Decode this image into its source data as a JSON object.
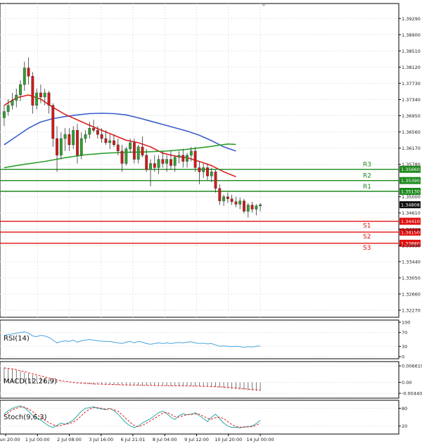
{
  "chart_data": {
    "type": "candlestick",
    "price_axis": {
      "min": 1.321,
      "max": 1.3965,
      "ticks": [
        "1.39290",
        "1.38900",
        "1.38510",
        "1.38120",
        "1.37730",
        "1.37340",
        "1.36950",
        "1.36560",
        "1.36170",
        "1.35780",
        "1.35000",
        "1.34610",
        "1.34220",
        "1.33830",
        "1.33440",
        "1.33050",
        "1.32660",
        "1.32270"
      ]
    },
    "time_axis": {
      "labels": [
        "30 Jun 20:00",
        "1 Jul 00:00",
        "2 Jul 08:00",
        "3 Jul 16:00",
        "6 Jul 21:01",
        "8 Jul 04:00",
        "9 Jul 12:00",
        "10 Jul 20:00",
        "14 Jul 00:00"
      ],
      "n_bars": 64
    },
    "current_price": {
      "label": "1.34808",
      "value": 1.34808
    },
    "candles": [
      [
        1.369,
        1.372,
        1.367,
        1.3705
      ],
      [
        1.3705,
        1.3735,
        1.3695,
        1.372
      ],
      [
        1.372,
        1.375,
        1.371,
        1.3732
      ],
      [
        1.3732,
        1.376,
        1.3715,
        1.3745
      ],
      [
        1.3745,
        1.378,
        1.373,
        1.377
      ],
      [
        1.377,
        1.3825,
        1.3755,
        1.381
      ],
      [
        1.381,
        1.3835,
        1.377,
        1.379
      ],
      [
        1.379,
        1.38,
        1.37,
        1.372
      ],
      [
        1.372,
        1.376,
        1.371,
        1.375
      ],
      [
        1.375,
        1.377,
        1.3725,
        1.374
      ],
      [
        1.374,
        1.376,
        1.372,
        1.375
      ],
      [
        1.375,
        1.3755,
        1.37,
        1.372
      ],
      [
        1.372,
        1.3725,
        1.362,
        1.364
      ],
      [
        1.364,
        1.367,
        1.356,
        1.36
      ],
      [
        1.36,
        1.3655,
        1.359,
        1.364
      ],
      [
        1.364,
        1.3665,
        1.361,
        1.365
      ],
      [
        1.365,
        1.3665,
        1.361,
        1.3625
      ],
      [
        1.3625,
        1.367,
        1.3615,
        1.366
      ],
      [
        1.366,
        1.3675,
        1.358,
        1.36
      ],
      [
        1.36,
        1.3655,
        1.359,
        1.364
      ],
      [
        1.364,
        1.366,
        1.363,
        1.365
      ],
      [
        1.365,
        1.368,
        1.364,
        1.3665
      ],
      [
        1.3665,
        1.3685,
        1.3655,
        1.366
      ],
      [
        1.366,
        1.367,
        1.364,
        1.365
      ],
      [
        1.365,
        1.3665,
        1.363,
        1.364
      ],
      [
        1.364,
        1.366,
        1.3625,
        1.363
      ],
      [
        1.363,
        1.365,
        1.3615,
        1.3635
      ],
      [
        1.3635,
        1.365,
        1.362,
        1.3625
      ],
      [
        1.3625,
        1.364,
        1.36,
        1.361
      ],
      [
        1.361,
        1.3625,
        1.356,
        1.358
      ],
      [
        1.358,
        1.362,
        1.3575,
        1.3615
      ],
      [
        1.3615,
        1.364,
        1.3605,
        1.363
      ],
      [
        1.363,
        1.364,
        1.358,
        1.359
      ],
      [
        1.359,
        1.3625,
        1.358,
        1.362
      ],
      [
        1.362,
        1.3645,
        1.3595,
        1.36
      ],
      [
        1.36,
        1.3615,
        1.356,
        1.3565
      ],
      [
        1.3565,
        1.359,
        1.3525,
        1.358
      ],
      [
        1.358,
        1.36,
        1.356,
        1.357
      ],
      [
        1.357,
        1.36,
        1.3555,
        1.359
      ],
      [
        1.359,
        1.361,
        1.357,
        1.358
      ],
      [
        1.358,
        1.36,
        1.356,
        1.359
      ],
      [
        1.359,
        1.361,
        1.3565,
        1.3575
      ],
      [
        1.3575,
        1.36,
        1.356,
        1.3595
      ],
      [
        1.3595,
        1.361,
        1.358,
        1.36
      ],
      [
        1.36,
        1.3615,
        1.357,
        1.3585
      ],
      [
        1.3585,
        1.3605,
        1.357,
        1.36
      ],
      [
        1.36,
        1.362,
        1.3585,
        1.361
      ],
      [
        1.361,
        1.362,
        1.356,
        1.357
      ],
      [
        1.357,
        1.3585,
        1.353,
        1.356
      ],
      [
        1.356,
        1.358,
        1.3545,
        1.357
      ],
      [
        1.357,
        1.358,
        1.354,
        1.355
      ],
      [
        1.355,
        1.357,
        1.3535,
        1.356
      ],
      [
        1.356,
        1.3565,
        1.351,
        1.352
      ],
      [
        1.352,
        1.353,
        1.348,
        1.349
      ],
      [
        1.349,
        1.3505,
        1.3478,
        1.35
      ],
      [
        1.35,
        1.351,
        1.3485,
        1.3495
      ],
      [
        1.3495,
        1.3505,
        1.348,
        1.3488
      ],
      [
        1.3488,
        1.35,
        1.3475,
        1.3482
      ],
      [
        1.3482,
        1.3498,
        1.347,
        1.349
      ],
      [
        1.349,
        1.3495,
        1.346,
        1.3465
      ],
      [
        1.3465,
        1.3485,
        1.345,
        1.348
      ],
      [
        1.348,
        1.3488,
        1.3462,
        1.347
      ],
      [
        1.347,
        1.3482,
        1.3455,
        1.3478
      ],
      [
        1.3478,
        1.3485,
        1.3465,
        1.34808
      ]
    ],
    "moving_averages": [
      {
        "color": "#3a5fcd",
        "values": [
          [
            0,
            1.3625
          ],
          [
            3,
            1.3645
          ],
          [
            6,
            1.3665
          ],
          [
            9,
            1.368
          ],
          [
            12,
            1.3688
          ],
          [
            15,
            1.3693
          ],
          [
            18,
            1.3697
          ],
          [
            21,
            1.37
          ],
          [
            24,
            1.3701
          ],
          [
            27,
            1.37
          ],
          [
            30,
            1.3697
          ],
          [
            33,
            1.369
          ],
          [
            36,
            1.3682
          ],
          [
            39,
            1.3674
          ],
          [
            42,
            1.3666
          ],
          [
            45,
            1.3658
          ],
          [
            48,
            1.3648
          ],
          [
            51,
            1.3635
          ],
          [
            54,
            1.362
          ],
          [
            57,
            1.361
          ]
        ]
      },
      {
        "color": "#e02020",
        "values": [
          [
            0,
            1.372
          ],
          [
            3,
            1.3738
          ],
          [
            6,
            1.3745
          ],
          [
            9,
            1.3735
          ],
          [
            12,
            1.3715
          ],
          [
            15,
            1.3698
          ],
          [
            18,
            1.3685
          ],
          [
            21,
            1.3672
          ],
          [
            24,
            1.366
          ],
          [
            27,
            1.3648
          ],
          [
            30,
            1.3636
          ],
          [
            33,
            1.363
          ],
          [
            36,
            1.362
          ],
          [
            39,
            1.3605
          ],
          [
            42,
            1.3598
          ],
          [
            45,
            1.3594
          ],
          [
            48,
            1.3585
          ],
          [
            51,
            1.3575
          ],
          [
            54,
            1.356
          ],
          [
            57,
            1.3548
          ]
        ]
      },
      {
        "color": "#2ea02e",
        "values": [
          [
            0,
            1.357
          ],
          [
            5,
            1.3578
          ],
          [
            10,
            1.3585
          ],
          [
            15,
            1.3594
          ],
          [
            20,
            1.3601
          ],
          [
            25,
            1.3605
          ],
          [
            30,
            1.3607
          ],
          [
            35,
            1.3608
          ],
          [
            40,
            1.361
          ],
          [
            45,
            1.3614
          ],
          [
            50,
            1.362
          ],
          [
            55,
            1.3627
          ],
          [
            57,
            1.3626
          ]
        ]
      }
    ],
    "levels": [
      {
        "name": "R3",
        "value": 1.3566,
        "label": "1.35660",
        "color": "#1e8a1e"
      },
      {
        "name": "R2",
        "value": 1.3539,
        "label": "1.35390",
        "color": "#1e8a1e"
      },
      {
        "name": "R1",
        "value": 1.3513,
        "label": "1.35130",
        "color": "#1e8a1e"
      },
      {
        "name": "S1",
        "value": 1.3441,
        "label": "1.34410",
        "color": "#e01010"
      },
      {
        "name": "S2",
        "value": 1.3415,
        "label": "1.34150",
        "color": "#e01010"
      },
      {
        "name": "S3",
        "value": 1.3388,
        "label": "1.33880",
        "color": "#e01010"
      }
    ],
    "indicators": [
      {
        "name": "RSI(14)",
        "scale": [
          0,
          100
        ],
        "ticks": [
          "100",
          "70",
          "30",
          "0"
        ],
        "lines": [
          {
            "color": "#4aa3df",
            "values": [
              62,
              64,
              66,
              68,
              70,
              72,
              68,
              60,
              58,
              62,
              60,
              56,
              48,
              40,
              44,
              46,
              44,
              48,
              42,
              46,
              48,
              50,
              48,
              46,
              45,
              44,
              44,
              42,
              40,
              38,
              42,
              44,
              40,
              44,
              42,
              38,
              36,
              38,
              40,
              38,
              40,
              38,
              40,
              41,
              40,
              42,
              43,
              40,
              38,
              39,
              37,
              38,
              34,
              30,
              31,
              30,
              29,
              30,
              29,
              27,
              29,
              28,
              30,
              31
            ]
          }
        ]
      },
      {
        "name": "MACD(12,26,9)",
        "scale": [
          -0.0055,
          0.0075
        ],
        "ticks": [
          "0.006619",
          "0.00",
          "-0.004405"
        ],
        "histogram": [
          0.006,
          0.0058,
          0.0055,
          0.005,
          0.0045,
          0.004,
          0.0036,
          0.003,
          0.0026,
          0.0022,
          0.0018,
          0.0014,
          0.001,
          0.0006,
          0.0003,
          0.0001,
          -0.0001,
          -0.0003,
          -0.0004,
          -0.0005,
          -0.0006,
          -0.0007,
          -0.0008,
          -0.0008,
          -0.0009,
          -0.0009,
          -0.001,
          -0.001,
          -0.0011,
          -0.0011,
          -0.0012,
          -0.0012,
          -0.0012,
          -0.0012,
          -0.0013,
          -0.0013,
          -0.0013,
          -0.0014,
          -0.0014,
          -0.0014,
          -0.0014,
          -0.0014,
          -0.0015,
          -0.0015,
          -0.0015,
          -0.0015,
          -0.0015,
          -0.0016,
          -0.0016,
          -0.0017,
          -0.0017,
          -0.0018,
          -0.0019,
          -0.0021,
          -0.0023,
          -0.0024,
          -0.0026,
          -0.0027,
          -0.0029,
          -0.0031,
          -0.0032,
          -0.0033,
          -0.0034,
          -0.0035
        ],
        "lines": [
          {
            "color": "#e02020",
            "values": [
              0.0058,
              0.0056,
              0.0054,
              0.0051,
              0.0047,
              0.0043,
              0.0039,
              0.0034,
              0.003,
              0.0026,
              0.0022,
              0.0018,
              0.0014,
              0.001,
              0.0007,
              0.0004,
              0.0002,
              0.0,
              -0.0002,
              -0.0003,
              -0.0004,
              -0.0005,
              -0.0006,
              -0.0007,
              -0.0007,
              -0.0008,
              -0.0008,
              -0.0009,
              -0.0009,
              -0.001,
              -0.001,
              -0.0011,
              -0.0011,
              -0.0011,
              -0.0012,
              -0.0012,
              -0.0012,
              -0.0013,
              -0.0013,
              -0.0013,
              -0.0013,
              -0.0014,
              -0.0014,
              -0.0014,
              -0.0014,
              -0.0015,
              -0.0015,
              -0.0015,
              -0.0015,
              -0.0016,
              -0.0016,
              -0.0017,
              -0.0017,
              -0.0018,
              -0.0019,
              -0.002,
              -0.0022,
              -0.0023,
              -0.0024,
              -0.0026,
              -0.0027,
              -0.0029,
              -0.003,
              -0.0031
            ]
          }
        ]
      },
      {
        "name": "Stoch(9,6,3)",
        "scale": [
          0,
          100
        ],
        "ticks": [
          "80",
          "20"
        ],
        "lines": [
          {
            "color": "#2aa8a8",
            "values": [
              60,
              72,
              80,
              85,
              88,
              82,
              70,
              55,
              48,
              40,
              30,
              20,
              15,
              22,
              30,
              26,
              32,
              40,
              55,
              70,
              80,
              82,
              85,
              80,
              78,
              75,
              80,
              72,
              60,
              45,
              30,
              20,
              15,
              20,
              30,
              38,
              45,
              55,
              65,
              70,
              62,
              50,
              42,
              55,
              62,
              58,
              60,
              65,
              55,
              45,
              35,
              50,
              60,
              45,
              30,
              20,
              15,
              16,
              14,
              17,
              18,
              20,
              28,
              40
            ]
          },
          {
            "color": "#e02020",
            "values": [
              55,
              65,
              75,
              80,
              84,
              84,
              78,
              68,
              58,
              50,
              40,
              32,
              24,
              20,
              22,
              26,
              28,
              33,
              42,
              55,
              68,
              77,
              82,
              82,
              80,
              77,
              78,
              75,
              70,
              58,
              45,
              32,
              22,
              18,
              22,
              30,
              38,
              46,
              55,
              63,
              66,
              60,
              52,
              50,
              55,
              58,
              59,
              61,
              60,
              53,
              46,
              43,
              48,
              50,
              45,
              35,
              25,
              18,
              16,
              16,
              17,
              18,
              22,
              30
            ]
          }
        ]
      }
    ]
  }
}
